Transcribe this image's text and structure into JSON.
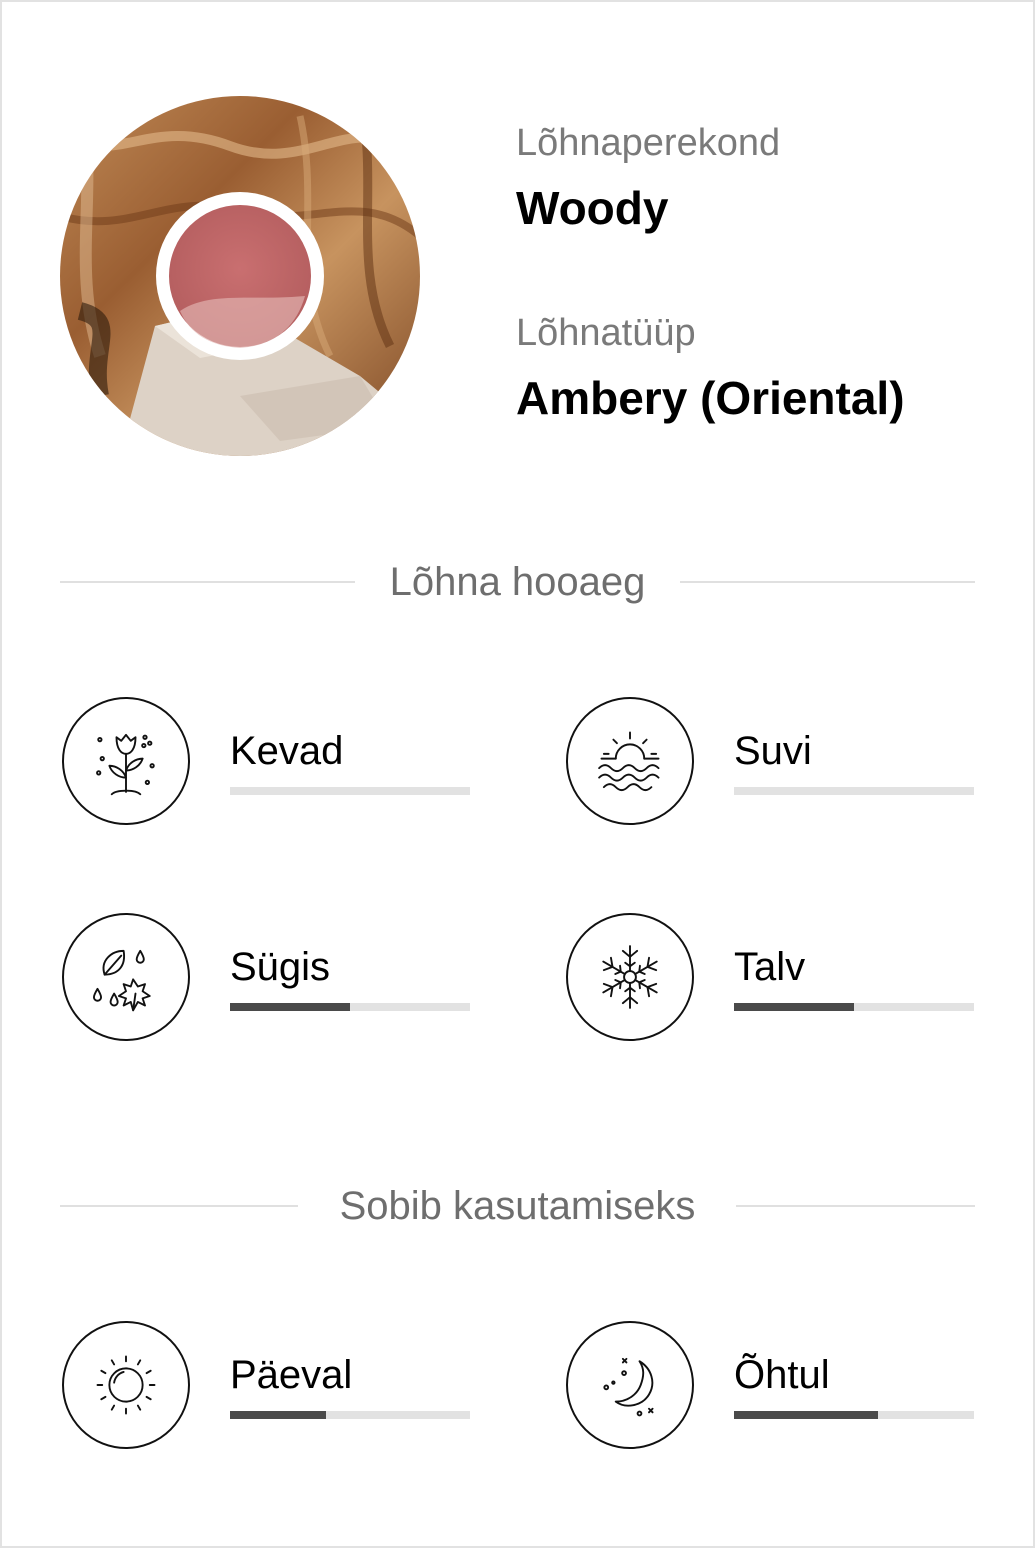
{
  "family": {
    "family_label": "Lõhnaperekond",
    "family_value": "Woody",
    "type_label": "Lõhnatüüp",
    "type_value": "Ambery (Oriental)",
    "accent_color": "#c96a6a"
  },
  "season": {
    "title": "Lõhna hooaeg",
    "items": [
      {
        "label": "Kevad",
        "icon": "spring-flower-icon",
        "level": 0.0
      },
      {
        "label": "Suvi",
        "icon": "summer-sun-waves-icon",
        "level": 0.0
      },
      {
        "label": "Sügis",
        "icon": "autumn-leaves-icon",
        "level": 0.5
      },
      {
        "label": "Talv",
        "icon": "winter-snowflake-icon",
        "level": 0.5
      }
    ]
  },
  "usage": {
    "title": "Sobib kasutamiseks",
    "items": [
      {
        "label": "Päeval",
        "icon": "day-sun-icon",
        "level": 0.4
      },
      {
        "label": "Õhtul",
        "icon": "night-moon-icon",
        "level": 0.6
      }
    ]
  }
}
